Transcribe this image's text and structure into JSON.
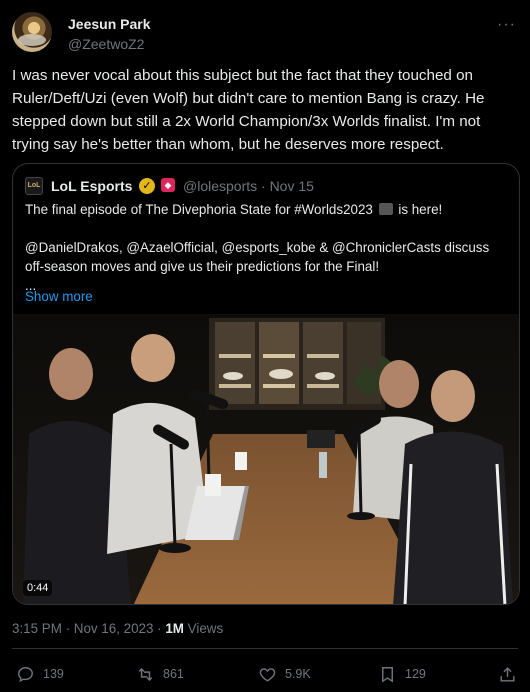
{
  "author": {
    "name": "Jeesun Park",
    "handle": "@ZeetwoZ2"
  },
  "tweet_text": "I was never vocal about this subject but the fact that they touched on Ruler/Deft/Uzi (even Wolf) but didn't care to mention Bang is crazy. He stepped down but still a 2x World Champion/3x Worlds finalist. I'm not trying say he's better than whom, but he deserves more respect.",
  "quote": {
    "logo_text": "LoL",
    "name": "LoL Esports",
    "handle_date": "@lolesports · Nov 15",
    "line1_a": "The final episode of The Divephoria State for #Worlds2023",
    "line1_b": "is here!",
    "line2": "@DanielDrakos, @AzaelOfficial, @esports_kobe & @ChroniclerCasts discuss off-season moves and give us their predictions for the Final!",
    "ellipsis": "...",
    "show_more": "Show more",
    "video_duration": "0:44"
  },
  "meta": {
    "time": "3:15 PM · Nov 16, 2023 · ",
    "views_num": "1M",
    "views_label": " Views"
  },
  "actions": {
    "replies": "139",
    "retweets": "861",
    "likes": "5.9K",
    "bookmarks": "129"
  },
  "icons": [
    "more-icon",
    "verified-icon",
    "reply-icon",
    "retweet-icon",
    "like-icon",
    "bookmark-icon",
    "share-icon"
  ],
  "colors": {
    "accent": "#1d9bf0",
    "muted": "#71767b",
    "text": "#e7e9ea",
    "border": "#2f3336",
    "verified_gold": "#e2b719"
  }
}
